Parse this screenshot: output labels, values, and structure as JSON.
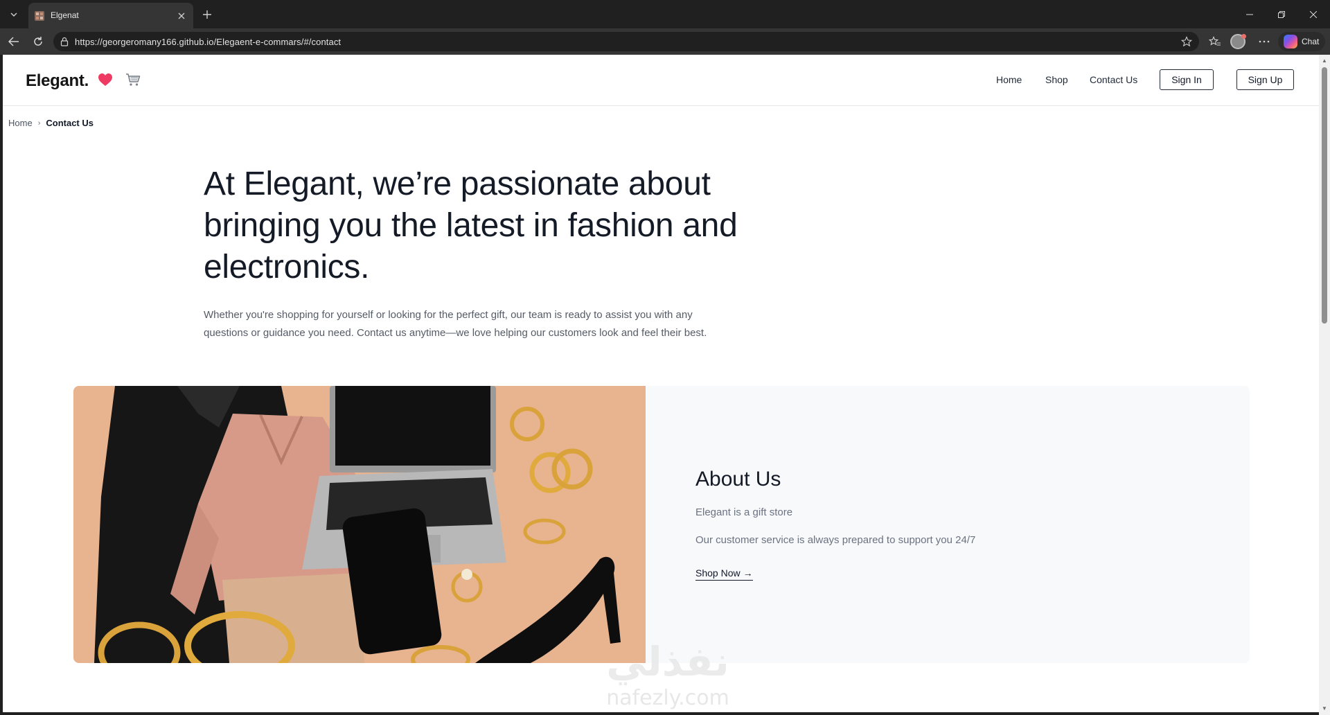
{
  "browser": {
    "tab_title": "Elgenat",
    "url": "https://georgeromany166.github.io/Elegaent-e-commars/#/contact",
    "chat_label": "Chat"
  },
  "site": {
    "logo": "Elegant.",
    "nav": [
      {
        "label": "Home"
      },
      {
        "label": "Shop"
      },
      {
        "label": "Contact Us"
      }
    ],
    "sign_in_label": "Sign In",
    "sign_up_label": "Sign Up"
  },
  "breadcrumb": {
    "home": "Home",
    "separator": "›",
    "current": "Contact Us"
  },
  "hero": {
    "title": "At Elegant, we’re passionate about bringing you the latest in fashion and electronics.",
    "text": "Whether you're shopping for yourself or looking for the perfect gift, our team is ready to assist you with any questions or guidance you need. Contact us anytime—we love helping our customers look and feel their best."
  },
  "about": {
    "title": "About Us",
    "line1": "Elegant is a gift store",
    "line2": "Our customer service is always prepared to support you 24/7",
    "cta_label": "Shop Now",
    "cta_arrow": "→"
  },
  "watermark": {
    "arabic": "نفذلي",
    "latin": "nafezly.com"
  },
  "colors": {
    "accent_heart": "#ef3b64",
    "text_dark": "#141a26",
    "card_bg": "#f7f9fb",
    "image_bg": "#e8b38f"
  },
  "icons": [
    "tab-list-icon",
    "close-icon",
    "plus-icon",
    "back-icon",
    "reload-icon",
    "lock-icon",
    "star-icon",
    "favorites-icon",
    "more-icon",
    "heart-icon",
    "cart-icon",
    "minimize-icon",
    "restore-icon"
  ]
}
